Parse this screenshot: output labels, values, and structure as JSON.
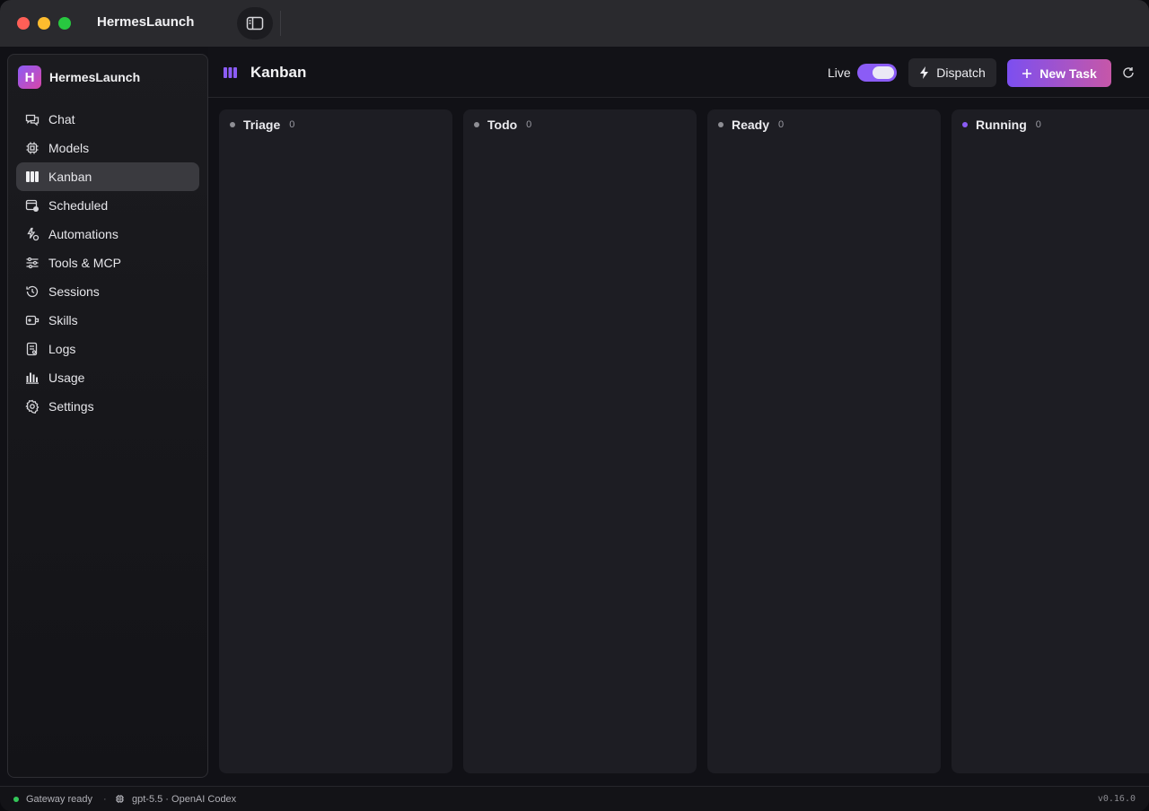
{
  "window": {
    "title": "HermesLaunch"
  },
  "sidebar": {
    "brand": {
      "logo_letter": "H",
      "name": "HermesLaunch"
    },
    "items": [
      {
        "label": "Chat",
        "icon": "chat-icon"
      },
      {
        "label": "Models",
        "icon": "cpu-icon"
      },
      {
        "label": "Kanban",
        "icon": "kanban-icon",
        "active": true
      },
      {
        "label": "Scheduled",
        "icon": "calendar-clock-icon"
      },
      {
        "label": "Automations",
        "icon": "automation-icon"
      },
      {
        "label": "Tools & MCP",
        "icon": "sliders-icon"
      },
      {
        "label": "Sessions",
        "icon": "history-icon"
      },
      {
        "label": "Skills",
        "icon": "skill-icon"
      },
      {
        "label": "Logs",
        "icon": "log-icon"
      },
      {
        "label": "Usage",
        "icon": "bar-chart-icon"
      },
      {
        "label": "Settings",
        "icon": "gear-icon"
      }
    ]
  },
  "header": {
    "title": "Kanban",
    "live_label": "Live",
    "live_enabled": true,
    "dispatch_label": "Dispatch",
    "new_task_label": "New Task"
  },
  "board": {
    "columns": [
      {
        "name": "Triage",
        "count": "0",
        "dot_color": "#8e8e94"
      },
      {
        "name": "Todo",
        "count": "0",
        "dot_color": "#8e8e94"
      },
      {
        "name": "Ready",
        "count": "0",
        "dot_color": "#8e8e94"
      },
      {
        "name": "Running",
        "count": "0",
        "dot_color": "#8b5cf6"
      }
    ]
  },
  "statusbar": {
    "gateway": "Gateway ready",
    "separator": "·",
    "model": "gpt-5.5 · OpenAI Codex",
    "version": "v0.16.0"
  },
  "colors": {
    "accent": "#8b5cf6",
    "accent_pink": "#c657a8",
    "status_ok": "#34c759"
  }
}
